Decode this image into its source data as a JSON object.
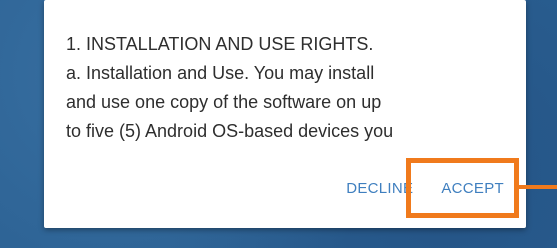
{
  "license": {
    "lines": [
      "1. INSTALLATION AND USE RIGHTS.",
      "a. Installation and Use. You may install",
      "and use one copy of the software on up",
      "to five (5) Android OS-based devices you"
    ]
  },
  "actions": {
    "decline_label": "DECLINE",
    "accept_label": "ACCEPT"
  },
  "colors": {
    "accent": "#3f7fbf",
    "highlight": "#f07a1c",
    "background": "#2a5f91"
  }
}
